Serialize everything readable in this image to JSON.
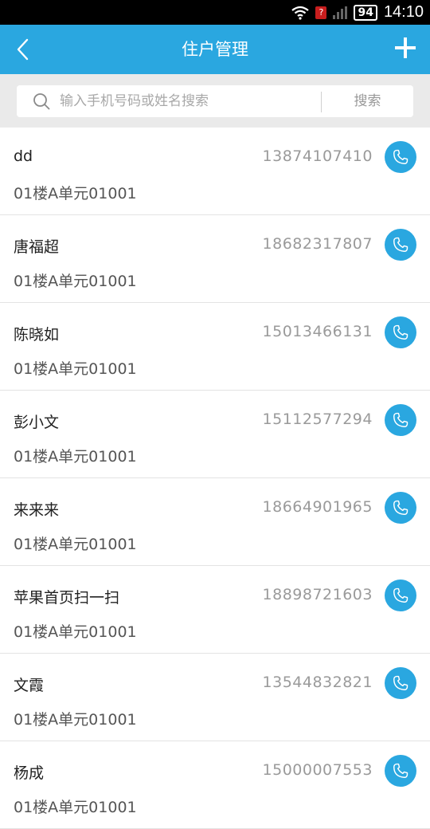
{
  "status_bar": {
    "time": "14:10",
    "battery": "94"
  },
  "header": {
    "title": "住户管理"
  },
  "search": {
    "placeholder": "输入手机号码或姓名搜索",
    "button_label": "搜索"
  },
  "residents": [
    {
      "name": "dd",
      "phone": "13874107410",
      "address": "01楼A单元01001"
    },
    {
      "name": "唐福超",
      "phone": "18682317807",
      "address": "01楼A单元01001"
    },
    {
      "name": "陈晓如",
      "phone": "15013466131",
      "address": "01楼A单元01001"
    },
    {
      "name": "彭小文",
      "phone": "15112577294",
      "address": "01楼A单元01001"
    },
    {
      "name": "来来来",
      "phone": "18664901965",
      "address": "01楼A单元01001"
    },
    {
      "name": "苹果首页扫一扫",
      "phone": "18898721603",
      "address": "01楼A单元01001"
    },
    {
      "name": "文霞",
      "phone": "13544832821",
      "address": "01楼A单元01001"
    },
    {
      "name": "杨成",
      "phone": "15000007553",
      "address": "01楼A单元01001"
    }
  ],
  "colors": {
    "accent": "#2aa7e0"
  }
}
